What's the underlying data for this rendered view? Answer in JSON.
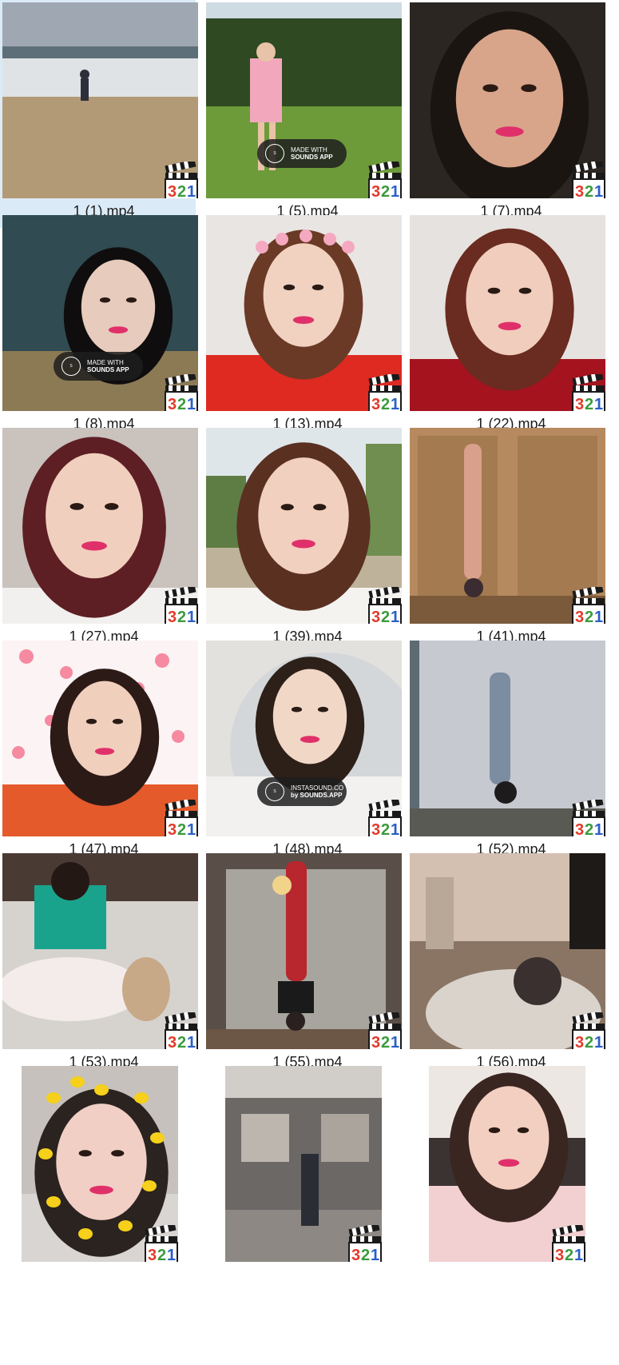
{
  "window": {
    "view": "Large icons"
  },
  "files": [
    {
      "name": "1 (1).mp4",
      "selected": true,
      "scene": "beach"
    },
    {
      "name": "1 (5).mp4",
      "selected": false,
      "scene": "golf",
      "badge": {
        "line1": "MADE WITH",
        "line2": "SOUNDS APP"
      }
    },
    {
      "name": "1 (7).mp4",
      "selected": false,
      "scene": "face-closeup"
    },
    {
      "name": "1 (8).mp4",
      "selected": false,
      "scene": "dark-portrait",
      "badge": {
        "line1": "MADE WITH",
        "line2": "SOUNDS APP"
      }
    },
    {
      "name": "1 (13).mp4",
      "selected": false,
      "scene": "flower-crown"
    },
    {
      "name": "1 (22).mp4",
      "selected": false,
      "scene": "red-top-portrait"
    },
    {
      "name": "1 (27).mp4",
      "selected": false,
      "scene": "indoor-portrait"
    },
    {
      "name": "1 (39).mp4",
      "selected": false,
      "scene": "outdoor-portrait"
    },
    {
      "name": "1 (41).mp4",
      "selected": false,
      "scene": "yoga-headstand-door"
    },
    {
      "name": "1 (47).mp4",
      "selected": false,
      "scene": "hearts-portrait"
    },
    {
      "name": "1 (48).mp4",
      "selected": false,
      "scene": "album-cover",
      "badge": {
        "line1": "INSTASOUND.CO",
        "line2": "by SOUNDS.APP"
      }
    },
    {
      "name": "1 (52).mp4",
      "selected": false,
      "scene": "yoga-headstand-curtain"
    },
    {
      "name": "1 (53).mp4",
      "selected": false,
      "scene": "floor-with-dog"
    },
    {
      "name": "1 (55).mp4",
      "selected": false,
      "scene": "headstand-window"
    },
    {
      "name": "1 (56).mp4",
      "selected": false,
      "scene": "dog-cafe"
    },
    {
      "name": "",
      "selected": false,
      "scene": "dot-filter",
      "narrow": true
    },
    {
      "name": "",
      "selected": false,
      "scene": "kitchen",
      "narrow": true
    },
    {
      "name": "",
      "selected": false,
      "scene": "pink-top-portrait",
      "narrow": true
    }
  ],
  "icon": {
    "name": "media-player-classic-icon",
    "label": "321",
    "colors": [
      "#e23a2a",
      "#3a9b3c",
      "#2b5fc7"
    ]
  }
}
